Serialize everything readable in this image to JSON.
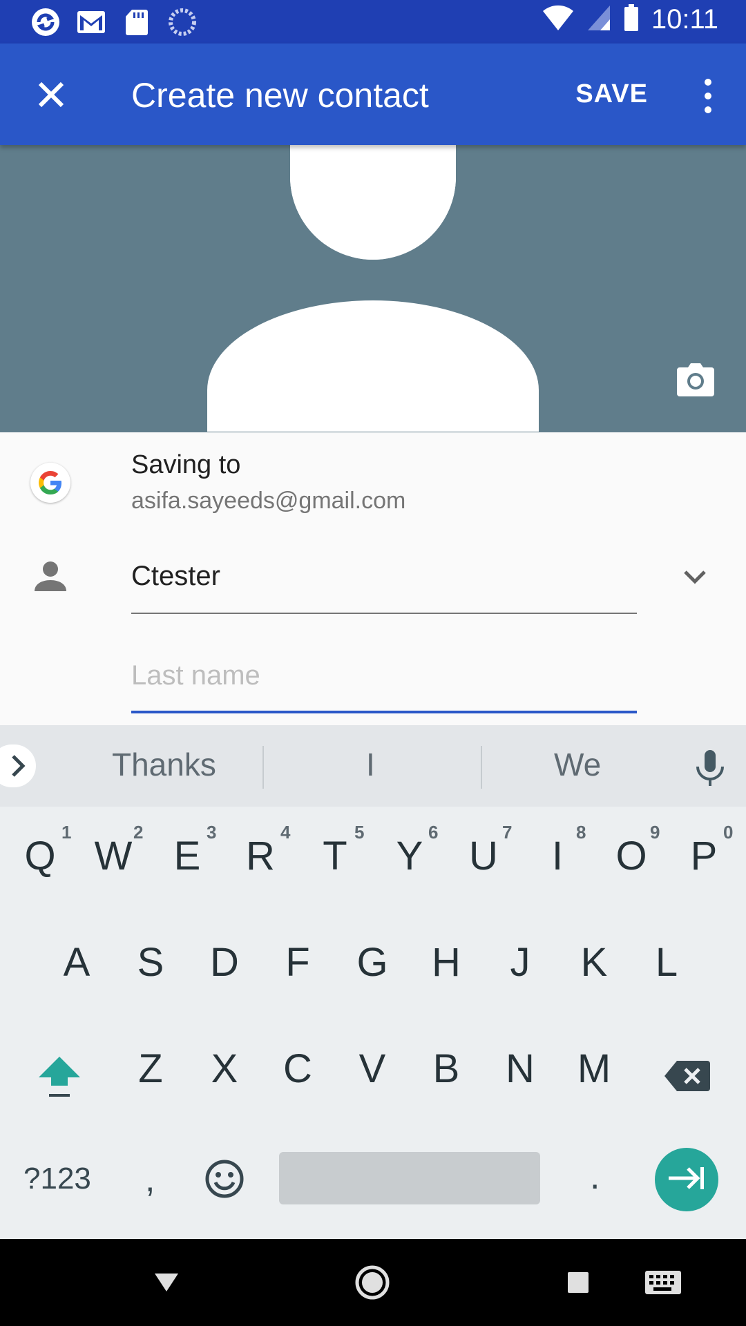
{
  "status_bar": {
    "time": "10:11",
    "left_icons": [
      "app-icon",
      "gmail-icon",
      "sd-card-icon",
      "sync-icon"
    ],
    "right_icons": [
      "wifi-icon",
      "signal-icon",
      "battery-icon"
    ]
  },
  "app_bar": {
    "title": "Create new contact",
    "save_label": "SAVE",
    "color": "#2a57c8"
  },
  "photo": {
    "background": "#607d8b"
  },
  "form": {
    "saving_to_label": "Saving to",
    "account_email": "asifa.sayeeds@gmail.com",
    "first_name_value": "Ctester",
    "last_name_placeholder": "Last name",
    "last_name_value": ""
  },
  "keyboard": {
    "suggestions": [
      "Thanks",
      "I",
      "We"
    ],
    "row1": [
      "Q",
      "W",
      "E",
      "R",
      "T",
      "Y",
      "U",
      "I",
      "O",
      "P"
    ],
    "row1_numbers": [
      "1",
      "2",
      "3",
      "4",
      "5",
      "6",
      "7",
      "8",
      "9",
      "0"
    ],
    "row2": [
      "A",
      "S",
      "D",
      "F",
      "G",
      "H",
      "J",
      "K",
      "L"
    ],
    "row3": [
      "Z",
      "X",
      "C",
      "V",
      "B",
      "N",
      "M"
    ],
    "symbols_label": "?123",
    "comma": ",",
    "period": ".",
    "accent": "#26a69a"
  }
}
